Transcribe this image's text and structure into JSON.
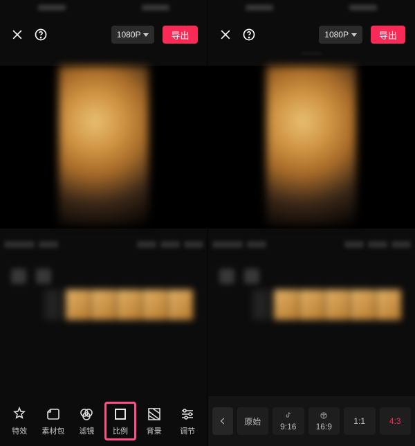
{
  "colors": {
    "accent": "#fa2a56",
    "highlight": "#ff4f8b"
  },
  "left": {
    "toolbar": {
      "close_icon": "close-icon",
      "help_icon": "help-icon",
      "resolution_label": "1080P",
      "export_label": "导出"
    },
    "bottom_tools": [
      {
        "icon": "effects-icon",
        "label": "特效"
      },
      {
        "icon": "sticker-icon",
        "label": "素材包"
      },
      {
        "icon": "filter-icon",
        "label": "滤镜"
      },
      {
        "icon": "ratio-icon",
        "label": "比例",
        "highlighted": true
      },
      {
        "icon": "background-icon",
        "label": "背景"
      },
      {
        "icon": "adjust-icon",
        "label": "调节"
      }
    ]
  },
  "right": {
    "toolbar": {
      "close_icon": "close-icon",
      "help_icon": "help-icon",
      "resolution_label": "1080P",
      "export_label": "导出"
    },
    "ratio_options": [
      {
        "label": "原始",
        "icon": "",
        "selected": false
      },
      {
        "label": "9:16",
        "icon": "tiktok-icon",
        "selected": false
      },
      {
        "label": "16:9",
        "icon": "xigua-icon",
        "selected": false
      },
      {
        "label": "1:1",
        "icon": "",
        "selected": false
      },
      {
        "label": "4:3",
        "icon": "",
        "selected": true
      }
    ],
    "back_icon": "chevron-left-icon"
  }
}
